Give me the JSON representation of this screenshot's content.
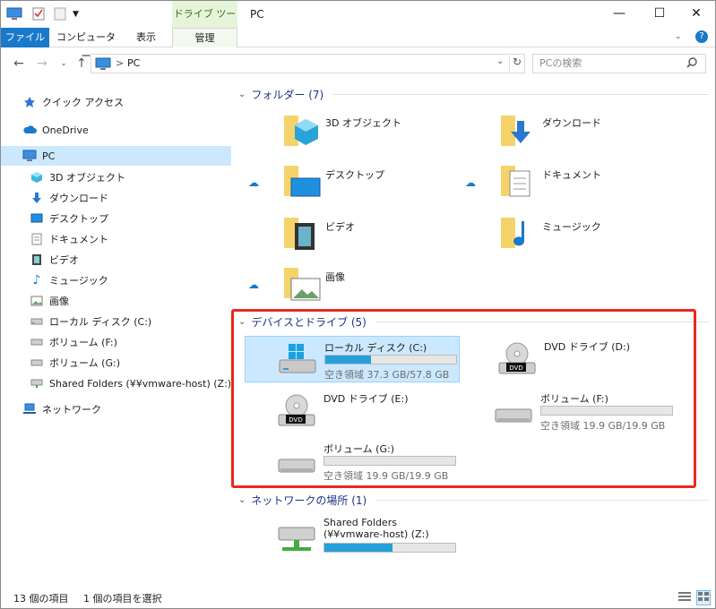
{
  "window": {
    "title": "PC",
    "minimize": "—",
    "maximize": "☐",
    "close": "✕"
  },
  "ribbon": {
    "context_group": "ドライブ ツール",
    "tabs": [
      {
        "label": "ファイル"
      },
      {
        "label": "コンピューター"
      },
      {
        "label": "表示"
      },
      {
        "label": "管理"
      }
    ],
    "help": "?"
  },
  "address": {
    "crumb_sep": ">",
    "location": "PC",
    "refresh": "↻"
  },
  "search": {
    "placeholder": "PCの検索"
  },
  "nav": {
    "quick_access": "クイック アクセス",
    "onedrive": "OneDrive",
    "pc": "PC",
    "pc_children": [
      {
        "label": "3D オブジェクト"
      },
      {
        "label": "ダウンロード"
      },
      {
        "label": "デスクトップ"
      },
      {
        "label": "ドキュメント"
      },
      {
        "label": "ビデオ"
      },
      {
        "label": "ミュージック"
      },
      {
        "label": "画像"
      },
      {
        "label": "ローカル ディスク (C:)"
      },
      {
        "label": "ボリューム (F:)"
      },
      {
        "label": "ボリューム (G:)"
      },
      {
        "label": "Shared Folders (¥¥vmware-host) (Z:)"
      }
    ],
    "network": "ネットワーク"
  },
  "folders_group": {
    "label": "フォルダー (7)",
    "items": [
      {
        "name": "3D オブジェクト"
      },
      {
        "name": "ダウンロード"
      },
      {
        "name": "デスクトップ"
      },
      {
        "name": "ドキュメント"
      },
      {
        "name": "ビデオ"
      },
      {
        "name": "ミュージック"
      },
      {
        "name": "画像"
      }
    ]
  },
  "devices_group": {
    "label": "デバイスとドライブ (5)",
    "drives": [
      {
        "name": "ローカル ディスク (C:)",
        "free": "空き領域 37.3 GB/57.8 GB",
        "used_fraction": 0.35,
        "kind": "windows-drive-icon"
      },
      {
        "name": "DVD ドライブ (D:)",
        "kind": "dvd-drive-icon"
      },
      {
        "name": "DVD ドライブ (E:)",
        "kind": "dvd-drive-icon"
      },
      {
        "name": "ボリューム (F:)",
        "free": "空き領域 19.9 GB/19.9 GB",
        "used_fraction": 0.0,
        "kind": "hdd-icon"
      },
      {
        "name": "ボリューム (G:)",
        "free": "空き領域 19.9 GB/19.9 GB",
        "used_fraction": 0.0,
        "kind": "hdd-icon"
      }
    ]
  },
  "network_group": {
    "label": "ネットワークの場所 (1)",
    "item": {
      "name_line1": "Shared Folders",
      "name_line2": "(¥¥vmware-host) (Z:)",
      "used_fraction": 0.52
    }
  },
  "status": {
    "count": "13 個の項目",
    "selected": "1 個の項目を選択"
  },
  "colors": {
    "accent": "#1979ca",
    "selection": "#cce8ff",
    "highlight_box": "#e8291c",
    "bar_fill": "#26a0da"
  }
}
